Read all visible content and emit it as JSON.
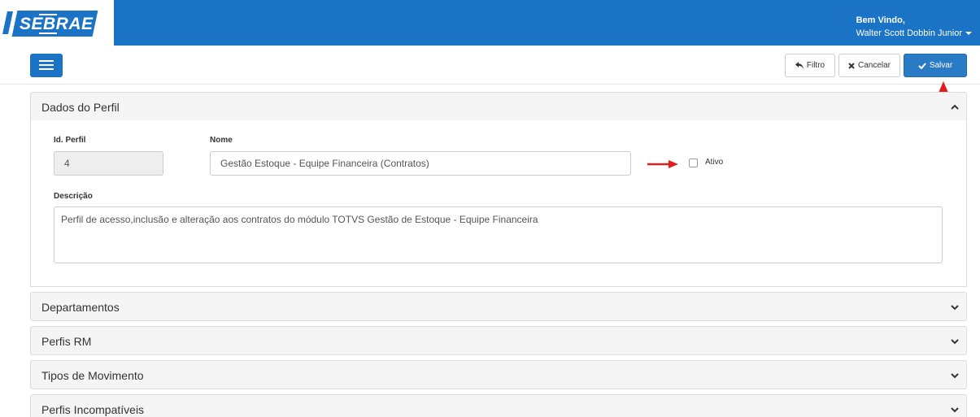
{
  "header": {
    "brand": "SEBRAE",
    "welcome": "Bem Vindo,",
    "user_name": "Walter Scott Dobbin Junior"
  },
  "toolbar": {
    "filtro_label": "Filtro",
    "cancelar_label": "Cancelar",
    "salvar_label": "Salvar"
  },
  "dados_perfil": {
    "title": "Dados do Perfil",
    "id_label": "Id. Perfil",
    "id_value": "4",
    "nome_label": "Nome",
    "nome_value": "Gestão Estoque - Equipe Financeira (Contratos)",
    "ativo_label": "Ativo",
    "descricao_label": "Descrição",
    "descricao_value": "Perfil de acesso,inclusão e alteração aos contratos do módulo TOTVS Gestão de Estoque - Equipe Financeira"
  },
  "sections": [
    {
      "title": "Departamentos"
    },
    {
      "title": "Perfis RM"
    },
    {
      "title": "Tipos de Movimento"
    },
    {
      "title": "Perfis Incompatíveis"
    }
  ],
  "colors": {
    "primary": "#1b73c6",
    "annotation_red": "#e02020"
  }
}
